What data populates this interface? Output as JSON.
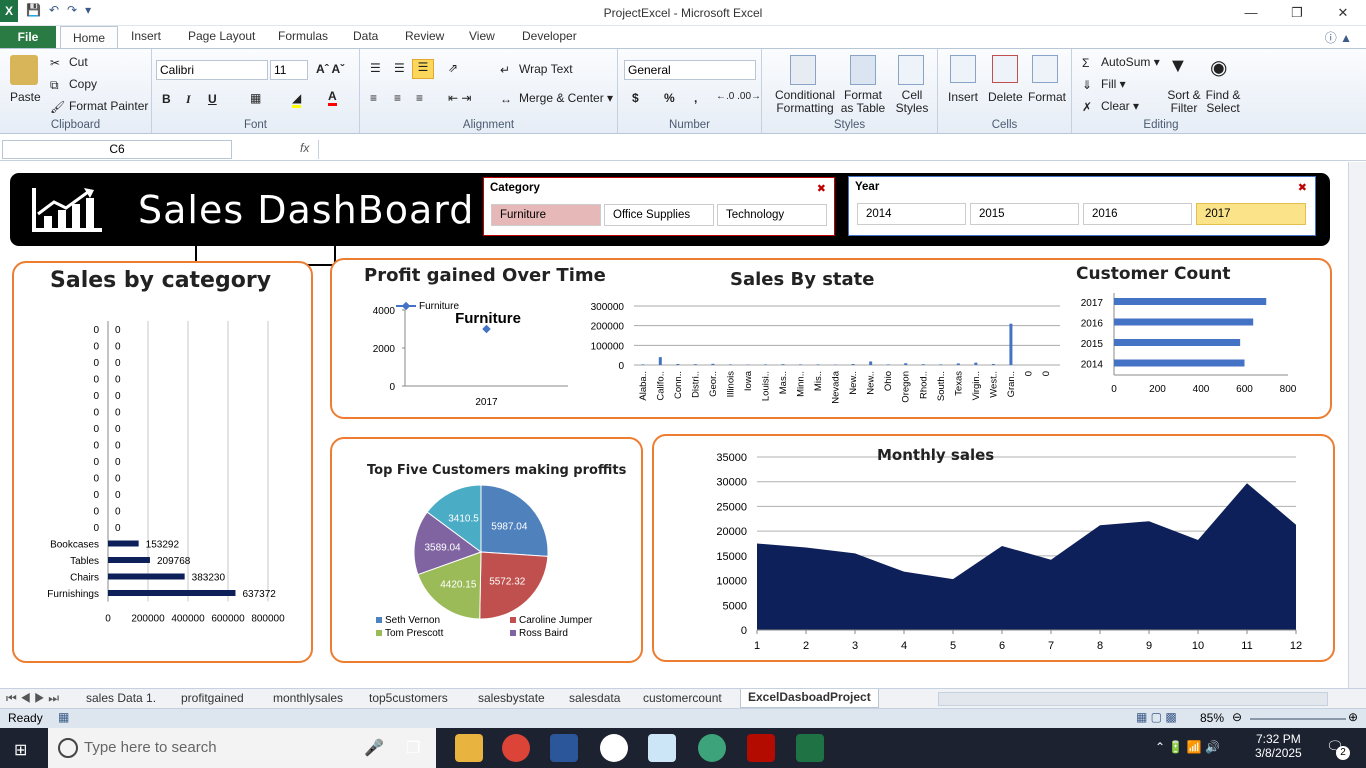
{
  "window": {
    "title": "ProjectExcel - Microsoft Excel",
    "app_icon": "X"
  },
  "tabs": {
    "file": "File",
    "items": [
      "Home",
      "Insert",
      "Page Layout",
      "Formulas",
      "Data",
      "Review",
      "View",
      "Developer"
    ]
  },
  "ribbon": {
    "clipboard": {
      "paste": "Paste",
      "cut": "Cut",
      "copy": "Copy",
      "format_painter": "Format Painter",
      "label": "Clipboard"
    },
    "font": {
      "name": "Calibri",
      "size": "11",
      "bold": "B",
      "italic": "I",
      "underline": "U",
      "label": "Font"
    },
    "alignment": {
      "wrap": "Wrap Text",
      "merge": "Merge & Center",
      "label": "Alignment"
    },
    "number": {
      "format": "General",
      "currency": "$",
      "percent": "%",
      "comma": ",",
      "label": "Number"
    },
    "styles": {
      "conditional": "Conditional Formatting",
      "format_table": "Format as Table",
      "cell_styles": "Cell Styles",
      "label": "Styles"
    },
    "cells": {
      "insert": "Insert",
      "delete": "Delete",
      "format": "Format",
      "label": "Cells"
    },
    "editing": {
      "autosum": "AutoSum",
      "fill": "Fill",
      "clear": "Clear",
      "sort": "Sort & Filter",
      "find": "Find & Select",
      "label": "Editing"
    }
  },
  "formula_bar": {
    "name_box": "C6",
    "fx": "fx",
    "value": ""
  },
  "dashboard": {
    "title": "Sales DashBoard",
    "category_slicer": {
      "header": "Category",
      "items": [
        "Furniture",
        "Office Supplies",
        "Technology"
      ],
      "selected": "Furniture"
    },
    "year_slicer": {
      "header": "Year",
      "items": [
        "2014",
        "2015",
        "2016",
        "2017"
      ],
      "selected": "2017"
    },
    "panel_titles": {
      "sales_by_category": "Sales by category",
      "profit": "Profit gained Over Time",
      "sales_state": "Sales By state",
      "customer_count": "Customer Count",
      "top5": "Top Five Customers making proffits",
      "monthly": "Monthly sales"
    }
  },
  "chart_data": [
    {
      "type": "bar",
      "title": "Sales by category",
      "orientation": "horizontal",
      "categories": [
        "0",
        "0",
        "0",
        "0",
        "0",
        "0",
        "0",
        "0",
        "0",
        "0",
        "0",
        "0",
        "0",
        "Bookcases",
        "Tables",
        "Chairs",
        "Furnishings"
      ],
      "values": [
        0,
        0,
        0,
        0,
        0,
        0,
        0,
        0,
        0,
        0,
        0,
        0,
        0,
        153292,
        209768,
        383230,
        637372
      ],
      "xlim": [
        0,
        800000
      ],
      "xticks": [
        "0",
        "200000",
        "400000",
        "600000",
        "800000"
      ],
      "color": "#0e2059"
    },
    {
      "type": "line",
      "title": "Profit gained Over Time",
      "subtitle": "Furniture",
      "series": [
        {
          "name": "Furniture",
          "values": [
            3000
          ]
        }
      ],
      "x": [
        "2017"
      ],
      "ylim": [
        0,
        4000
      ],
      "yticks": [
        "0",
        "2000",
        "4000"
      ],
      "color": "#4472c4"
    },
    {
      "type": "bar",
      "title": "Sales By state",
      "categories": [
        "Alaba..",
        "Califo..",
        "Conn..",
        "Distri..",
        "Geor..",
        "Illinois",
        "Iowa",
        "Louisi..",
        "Mas..",
        "Minn..",
        "Mis..",
        "Nevada",
        "New..",
        "New..",
        "Ohio",
        "Oregon",
        "Rhod..",
        "South..",
        "Texas",
        "Virgin..",
        "West..",
        "Gran..",
        "0",
        "0"
      ],
      "values": [
        3000,
        40000,
        5000,
        4000,
        6000,
        3000,
        2000,
        3000,
        4000,
        3000,
        3000,
        2000,
        5000,
        18000,
        3000,
        9000,
        4000,
        3000,
        8000,
        12000,
        5000,
        210000,
        0,
        0
      ],
      "ylim": [
        0,
        300000
      ],
      "yticks": [
        "0",
        "100000",
        "200000",
        "300000"
      ],
      "color": "#4472c4"
    },
    {
      "type": "bar",
      "title": "Customer Count",
      "orientation": "horizontal",
      "categories": [
        "2014",
        "2015",
        "2016",
        "2017"
      ],
      "values": [
        600,
        580,
        640,
        700
      ],
      "xlim": [
        0,
        800
      ],
      "xticks": [
        "0",
        "200",
        "400",
        "600",
        "800"
      ],
      "color": "#4472c4"
    },
    {
      "type": "pie",
      "title": "Top Five Customers making proffits",
      "labels": [
        "Seth Vernon",
        "Caroline Jumper",
        "Tom Prescott",
        "Ross Baird",
        ""
      ],
      "values": [
        5987.04,
        5572.32,
        4420.15,
        3589.04,
        3410.5
      ],
      "value_labels": [
        "5987.04",
        "5572.32",
        "4420.15",
        "3589.04",
        "3410.5"
      ],
      "colors": [
        "#4f81bd",
        "#c0504d",
        "#9bbb59",
        "#8064a2",
        "#4bacc6"
      ]
    },
    {
      "type": "area",
      "title": "Monthly sales",
      "x": [
        "1",
        "2",
        "3",
        "4",
        "5",
        "6",
        "7",
        "8",
        "9",
        "10",
        "11",
        "12"
      ],
      "values": [
        17500,
        16700,
        15500,
        11800,
        10300,
        17000,
        14200,
        21200,
        22000,
        18200,
        29700,
        21300
      ],
      "ylim": [
        0,
        35000
      ],
      "yticks": [
        "0",
        "5000",
        "10000",
        "15000",
        "20000",
        "25000",
        "30000",
        "35000"
      ],
      "color": "#0e2059"
    }
  ],
  "sheet_tabs": [
    "sales Data 1.",
    "profitgained",
    "monthlysales",
    "top5customers",
    "salesbystate",
    "salesdata",
    "customercount",
    "ExcelDasboadProject"
  ],
  "active_sheet": "ExcelDasboadProject",
  "status": {
    "ready": "Ready",
    "zoom": "85%"
  },
  "taskbar": {
    "search_placeholder": "Type here to search",
    "time": "7:32 PM",
    "date": "3/8/2025",
    "notifications": "2"
  }
}
